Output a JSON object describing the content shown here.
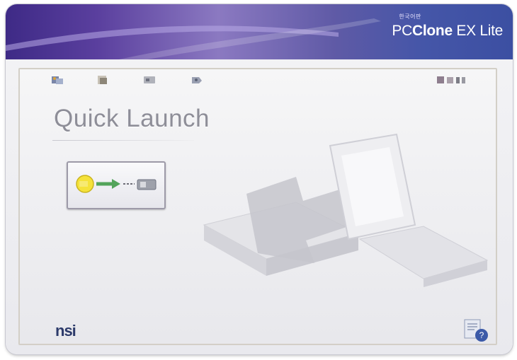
{
  "titlebar": {
    "tagline": "한국어판",
    "product_light": "PC",
    "product_bold": "Clone",
    "product_rest": " EX Lite"
  },
  "toolbar": {
    "icons": [
      "backup-icon",
      "restore-icon",
      "drive-icon",
      "settings-icon",
      "options-icon"
    ]
  },
  "main": {
    "title": "Quick Launch",
    "quick_launch_button_icon": "backup-to-drive-icon"
  },
  "footer": {
    "logo": "nsi",
    "help_icon": "help-icon"
  },
  "colors": {
    "titlebar_dark": "#3e2a86",
    "titlebar_light": "#8b79c1",
    "heading": "#8e8e98"
  }
}
